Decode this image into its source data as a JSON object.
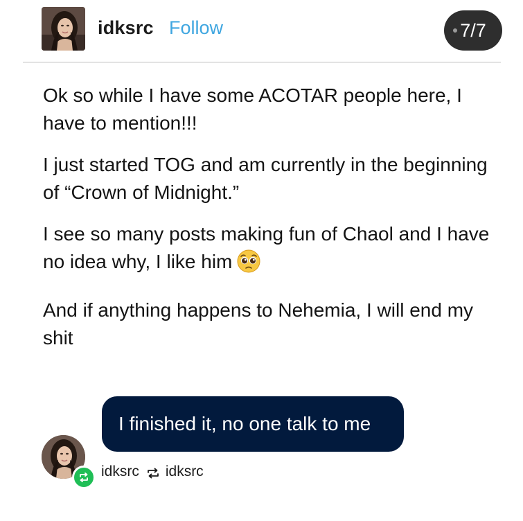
{
  "header": {
    "username": "idksrc",
    "follow_label": "Follow",
    "page_indicator": "7/7",
    "avatar_icon": "profile-photo"
  },
  "post": {
    "paragraphs": [
      "Ok so while I have some ACOTAR people here, I have to mention!!!",
      "I just started TOG and am currently in the beginning of “Crown of Midnight.”",
      "I see so many posts making fun of Chaol and I have no idea why, I like him",
      "And if anything happens to Nehemia, I will end my shit"
    ],
    "emoji_icon": "pleading-face-emoji"
  },
  "reply": {
    "text": "I finished it, no one talk to me"
  },
  "footer": {
    "reblogger": "idksrc",
    "source": "idksrc",
    "reblog_icon": "reblog-icon"
  },
  "colors": {
    "follow": "#3fa6e0",
    "badge_bg": "#2e2e2e",
    "reply_bg": "#021a3d",
    "reblog_green": "#1fbe56"
  }
}
